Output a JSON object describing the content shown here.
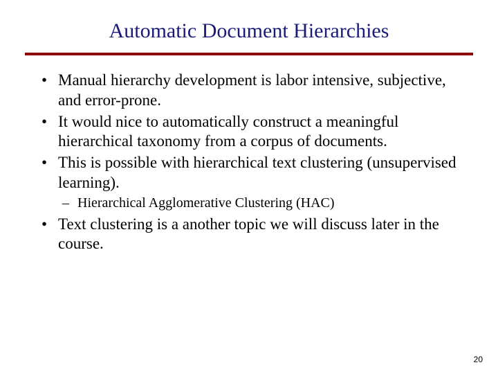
{
  "title": "Automatic Document Hierarchies",
  "bullets": [
    "Manual hierarchy development is labor intensive, subjective, and error-prone.",
    "It would nice to automatically construct a meaningful hierarchical taxonomy from a corpus of documents.",
    "This is possible with hierarchical text clustering (unsupervised learning)."
  ],
  "sub": [
    "Hierarchical Agglomerative Clustering (HAC)"
  ],
  "bullets2": [
    "Text clustering is a another topic we will discuss later in the course."
  ],
  "page_number": "20"
}
